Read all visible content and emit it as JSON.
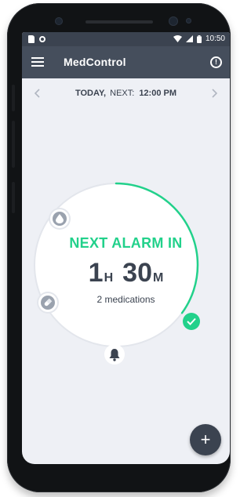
{
  "status_bar": {
    "time": "10:50"
  },
  "app_bar": {
    "title": "MedControl",
    "info_label": "!"
  },
  "date_bar": {
    "today_label": "TODAY,",
    "next_label": "NEXT:",
    "next_time": "12:00 PM"
  },
  "countdown": {
    "heading": "NEXT ALARM IN",
    "hours": "1",
    "hours_unit": "H",
    "minutes": "30",
    "minutes_unit": "M",
    "medications_text": "2 medications",
    "progress_fraction": 0.35
  },
  "icons": {
    "menu": "menu-icon",
    "info": "info-icon",
    "drop": "water-drop-icon",
    "pill": "pill-icon",
    "bell": "bell-icon",
    "check": "check-icon",
    "add": "plus-icon"
  },
  "fab": {
    "label": "+"
  },
  "colors": {
    "accent": "#22d18b",
    "app_bar": "#454e5c",
    "status_bar": "#3b4350",
    "background": "#eef0f5",
    "text_dark": "#3b4350"
  }
}
